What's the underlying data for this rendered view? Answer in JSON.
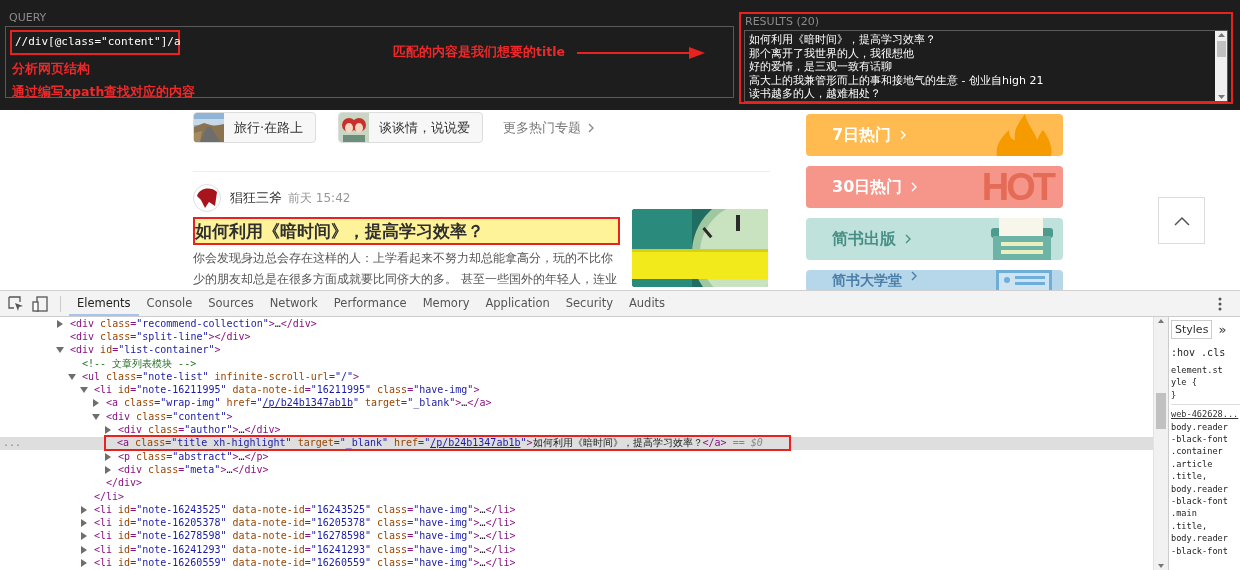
{
  "xpath_helper": {
    "query_label": "QUERY",
    "query": "//div[@class=\"content\"]/a",
    "annotations": [
      "分析网页结构",
      "通过编写xpath查找对应的内容"
    ],
    "arrow_note": "匹配的内容是我们想要的title",
    "results_label": "RESULTS (20)",
    "results": [
      "如何利用《暗时间》，提高学习效率？",
      "那个离开了我世界的人，我很想他",
      "好的爱情，是三观一致有话聊",
      "高大上的我兼管形而上的事和接地气的生意 - 创业自high 21",
      "读书越多的人，越难相处？"
    ]
  },
  "page": {
    "topics": [
      {
        "label": "旅行·在路上",
        "kind": "road"
      },
      {
        "label": "谈谈情，说说爱",
        "kind": "pair"
      }
    ],
    "more_topics": "更多热门专题",
    "article": {
      "author": "猖狂三斧",
      "time": "前天 15:42",
      "title": "如何利用《暗时间》，提高学习效率？",
      "framed": true,
      "abstract": "你会发现身边总会存在这样的人：上学看起来不努力却总能拿高分，玩的不比你少的朋友却总是在很多方面成就要比同侪大的多。 甚至一些国外的年轻人，连业"
    },
    "side_cards": [
      {
        "label": "7日热门",
        "kind": "flame",
        "color": "#ffbb4f"
      },
      {
        "label": "30日热门",
        "kind": "hot",
        "badge": "HOT",
        "color": "#f6968a"
      },
      {
        "label": "简书出版",
        "kind": "typewriter",
        "color": "#bfe3dc"
      },
      {
        "label": "简书大学堂",
        "kind": "board",
        "color": "#b6d6ea"
      }
    ]
  },
  "devtools": {
    "tabs": [
      {
        "label": "Elements",
        "selected": true
      },
      {
        "label": "Console",
        "selected": false
      },
      {
        "label": "Sources",
        "selected": false
      },
      {
        "label": "Network",
        "selected": false
      },
      {
        "label": "Performance",
        "selected": false
      },
      {
        "label": "Memory",
        "selected": false
      },
      {
        "label": "Application",
        "selected": false
      },
      {
        "label": "Security",
        "selected": false
      },
      {
        "label": "Audits",
        "selected": false
      }
    ],
    "tree": [
      {
        "kind": "toggle",
        "expanded": false,
        "selected": false,
        "tokens": [
          {
            "kind": "tag",
            "text": "<div"
          },
          {
            "kind": "attr",
            "text": " class"
          },
          {
            "kind": "punct",
            "text": "="
          },
          {
            "kind": "val",
            "text": "\"recommend-collection\""
          },
          {
            "kind": "tag",
            "text": ">"
          },
          {
            "kind": "text",
            "text": "…"
          },
          {
            "kind": "tag",
            "text": "</div>"
          }
        ]
      },
      {
        "kind": "leaf",
        "selected": false,
        "tokens": [
          {
            "kind": "tag",
            "text": "<div"
          },
          {
            "kind": "attr",
            "text": " class"
          },
          {
            "kind": "punct",
            "text": "="
          },
          {
            "kind": "val",
            "text": "\"split-line\""
          },
          {
            "kind": "tag",
            "text": "></div>"
          }
        ]
      },
      {
        "kind": "toggle",
        "expanded": true,
        "selected": false,
        "tokens": [
          {
            "kind": "tag",
            "text": "<div"
          },
          {
            "kind": "attr",
            "text": " id"
          },
          {
            "kind": "punct",
            "text": "="
          },
          {
            "kind": "val",
            "text": "\"list-container\""
          },
          {
            "kind": "tag",
            "text": ">"
          }
        ],
        "children": [
          {
            "kind": "leaf",
            "selected": false,
            "tokens": [
              {
                "kind": "comment",
                "text": "<!-- 文章列表模块 -->"
              }
            ]
          },
          {
            "kind": "toggle",
            "expanded": true,
            "selected": false,
            "tokens": [
              {
                "kind": "tag",
                "text": "<ul"
              },
              {
                "kind": "attr",
                "text": " class"
              },
              {
                "kind": "punct",
                "text": "="
              },
              {
                "kind": "val",
                "text": "\"note-list\""
              },
              {
                "kind": "attr",
                "text": " infinite-scroll-url"
              },
              {
                "kind": "punct",
                "text": "="
              },
              {
                "kind": "val",
                "text": "\"/\""
              },
              {
                "kind": "tag",
                "text": ">"
              }
            ],
            "children": [
              {
                "kind": "toggle",
                "expanded": true,
                "selected": false,
                "tokens": [
                  {
                    "kind": "tag",
                    "text": "<li"
                  },
                  {
                    "kind": "attr",
                    "text": " id"
                  },
                  {
                    "kind": "punct",
                    "text": "="
                  },
                  {
                    "kind": "val",
                    "text": "\"note-16211995\""
                  },
                  {
                    "kind": "attr",
                    "text": " data-note-id"
                  },
                  {
                    "kind": "punct",
                    "text": "="
                  },
                  {
                    "kind": "val",
                    "text": "\"16211995\""
                  },
                  {
                    "kind": "attr",
                    "text": " class"
                  },
                  {
                    "kind": "punct",
                    "text": "="
                  },
                  {
                    "kind": "val",
                    "text": "\"have-img\""
                  },
                  {
                    "kind": "tag",
                    "text": ">"
                  }
                ],
                "close": [
                  {
                    "kind": "tag",
                    "text": "</li>"
                  }
                ],
                "children": [
                  {
                    "kind": "toggle",
                    "expanded": false,
                    "selected": false,
                    "tokens": [
                      {
                        "kind": "tag",
                        "text": "<a"
                      },
                      {
                        "kind": "attr",
                        "text": " class"
                      },
                      {
                        "kind": "punct",
                        "text": "="
                      },
                      {
                        "kind": "val",
                        "text": "\"wrap-img\""
                      },
                      {
                        "kind": "attr",
                        "text": " href"
                      },
                      {
                        "kind": "punct",
                        "text": "="
                      },
                      {
                        "kind": "val",
                        "text": "\""
                      },
                      {
                        "kind": "link",
                        "text": "/p/b24b1347ab1b"
                      },
                      {
                        "kind": "val",
                        "text": "\""
                      },
                      {
                        "kind": "attr",
                        "text": " target"
                      },
                      {
                        "kind": "punct",
                        "text": "="
                      },
                      {
                        "kind": "val",
                        "text": "\"_blank\""
                      },
                      {
                        "kind": "tag",
                        "text": ">"
                      },
                      {
                        "kind": "text",
                        "text": "…"
                      },
                      {
                        "kind": "tag",
                        "text": "</a>"
                      }
                    ]
                  },
                  {
                    "kind": "toggle",
                    "expanded": true,
                    "selected": false,
                    "tokens": [
                      {
                        "kind": "tag",
                        "text": "<div"
                      },
                      {
                        "kind": "attr",
                        "text": " class"
                      },
                      {
                        "kind": "punct",
                        "text": "="
                      },
                      {
                        "kind": "val",
                        "text": "\"content\""
                      },
                      {
                        "kind": "tag",
                        "text": ">"
                      }
                    ],
                    "close": [
                      {
                        "kind": "tag",
                        "text": "</div>"
                      }
                    ],
                    "children": [
                      {
                        "kind": "toggle",
                        "expanded": false,
                        "selected": false,
                        "tokens": [
                          {
                            "kind": "tag",
                            "text": "<div"
                          },
                          {
                            "kind": "attr",
                            "text": " class"
                          },
                          {
                            "kind": "punct",
                            "text": "="
                          },
                          {
                            "kind": "val",
                            "text": "\"author\""
                          },
                          {
                            "kind": "tag",
                            "text": ">"
                          },
                          {
                            "kind": "text",
                            "text": "…"
                          },
                          {
                            "kind": "tag",
                            "text": "</div>"
                          }
                        ]
                      },
                      {
                        "kind": "leaf",
                        "selected": true,
                        "framed": true,
                        "gutter": "...",
                        "tokens": [
                          {
                            "kind": "tag",
                            "text": "<a"
                          },
                          {
                            "kind": "attr",
                            "text": " class"
                          },
                          {
                            "kind": "punct",
                            "text": "="
                          },
                          {
                            "kind": "val",
                            "text": "\"title xh-highlight\""
                          },
                          {
                            "kind": "attr",
                            "text": " target"
                          },
                          {
                            "kind": "punct",
                            "text": "="
                          },
                          {
                            "kind": "val",
                            "text": "\"_blank\""
                          },
                          {
                            "kind": "attr",
                            "text": " href"
                          },
                          {
                            "kind": "punct",
                            "text": "="
                          },
                          {
                            "kind": "val",
                            "text": "\""
                          },
                          {
                            "kind": "link",
                            "text": "/p/b24b1347ab1b"
                          },
                          {
                            "kind": "val",
                            "text": "\""
                          },
                          {
                            "kind": "tag",
                            "text": ">"
                          },
                          {
                            "kind": "text",
                            "text": "如何利用《暗时间》，提高学习效率？"
                          },
                          {
                            "kind": "tag",
                            "text": "</a>"
                          },
                          {
                            "kind": "ref",
                            "text": " == $0"
                          }
                        ]
                      },
                      {
                        "kind": "toggle",
                        "expanded": false,
                        "selected": false,
                        "tokens": [
                          {
                            "kind": "tag",
                            "text": "<p"
                          },
                          {
                            "kind": "attr",
                            "text": " class"
                          },
                          {
                            "kind": "punct",
                            "text": "="
                          },
                          {
                            "kind": "val",
                            "text": "\"abstract\""
                          },
                          {
                            "kind": "tag",
                            "text": ">"
                          },
                          {
                            "kind": "text",
                            "text": "…"
                          },
                          {
                            "kind": "tag",
                            "text": "</p>"
                          }
                        ]
                      },
                      {
                        "kind": "toggle",
                        "expanded": false,
                        "selected": false,
                        "tokens": [
                          {
                            "kind": "tag",
                            "text": "<div"
                          },
                          {
                            "kind": "attr",
                            "text": " class"
                          },
                          {
                            "kind": "punct",
                            "text": "="
                          },
                          {
                            "kind": "val",
                            "text": "\"meta\""
                          },
                          {
                            "kind": "tag",
                            "text": ">"
                          },
                          {
                            "kind": "text",
                            "text": "…"
                          },
                          {
                            "kind": "tag",
                            "text": "</div>"
                          }
                        ]
                      }
                    ]
                  }
                ]
              },
              {
                "kind": "toggle",
                "expanded": false,
                "selected": false,
                "tokens": [
                  {
                    "kind": "tag",
                    "text": "<li"
                  },
                  {
                    "kind": "attr",
                    "text": " id"
                  },
                  {
                    "kind": "punct",
                    "text": "="
                  },
                  {
                    "kind": "val",
                    "text": "\"note-16243525\""
                  },
                  {
                    "kind": "attr",
                    "text": " data-note-id"
                  },
                  {
                    "kind": "punct",
                    "text": "="
                  },
                  {
                    "kind": "val",
                    "text": "\"16243525\""
                  },
                  {
                    "kind": "attr",
                    "text": " class"
                  },
                  {
                    "kind": "punct",
                    "text": "="
                  },
                  {
                    "kind": "val",
                    "text": "\"have-img\""
                  },
                  {
                    "kind": "tag",
                    "text": ">"
                  },
                  {
                    "kind": "text",
                    "text": "…"
                  },
                  {
                    "kind": "tag",
                    "text": "</li>"
                  }
                ]
              },
              {
                "kind": "toggle",
                "expanded": false,
                "selected": false,
                "tokens": [
                  {
                    "kind": "tag",
                    "text": "<li"
                  },
                  {
                    "kind": "attr",
                    "text": " id"
                  },
                  {
                    "kind": "punct",
                    "text": "="
                  },
                  {
                    "kind": "val",
                    "text": "\"note-16205378\""
                  },
                  {
                    "kind": "attr",
                    "text": " data-note-id"
                  },
                  {
                    "kind": "punct",
                    "text": "="
                  },
                  {
                    "kind": "val",
                    "text": "\"16205378\""
                  },
                  {
                    "kind": "attr",
                    "text": " class"
                  },
                  {
                    "kind": "punct",
                    "text": "="
                  },
                  {
                    "kind": "val",
                    "text": "\"have-img\""
                  },
                  {
                    "kind": "tag",
                    "text": ">"
                  },
                  {
                    "kind": "text",
                    "text": "…"
                  },
                  {
                    "kind": "tag",
                    "text": "</li>"
                  }
                ]
              },
              {
                "kind": "toggle",
                "expanded": false,
                "selected": false,
                "tokens": [
                  {
                    "kind": "tag",
                    "text": "<li"
                  },
                  {
                    "kind": "attr",
                    "text": " id"
                  },
                  {
                    "kind": "punct",
                    "text": "="
                  },
                  {
                    "kind": "val",
                    "text": "\"note-16278598\""
                  },
                  {
                    "kind": "attr",
                    "text": " data-note-id"
                  },
                  {
                    "kind": "punct",
                    "text": "="
                  },
                  {
                    "kind": "val",
                    "text": "\"16278598\""
                  },
                  {
                    "kind": "attr",
                    "text": " class"
                  },
                  {
                    "kind": "punct",
                    "text": "="
                  },
                  {
                    "kind": "val",
                    "text": "\"have-img\""
                  },
                  {
                    "kind": "tag",
                    "text": ">"
                  },
                  {
                    "kind": "text",
                    "text": "…"
                  },
                  {
                    "kind": "tag",
                    "text": "</li>"
                  }
                ]
              },
              {
                "kind": "toggle",
                "expanded": false,
                "selected": false,
                "tokens": [
                  {
                    "kind": "tag",
                    "text": "<li"
                  },
                  {
                    "kind": "attr",
                    "text": " id"
                  },
                  {
                    "kind": "punct",
                    "text": "="
                  },
                  {
                    "kind": "val",
                    "text": "\"note-16241293\""
                  },
                  {
                    "kind": "attr",
                    "text": " data-note-id"
                  },
                  {
                    "kind": "punct",
                    "text": "="
                  },
                  {
                    "kind": "val",
                    "text": "\"16241293\""
                  },
                  {
                    "kind": "attr",
                    "text": " class"
                  },
                  {
                    "kind": "punct",
                    "text": "="
                  },
                  {
                    "kind": "val",
                    "text": "\"have-img\""
                  },
                  {
                    "kind": "tag",
                    "text": ">"
                  },
                  {
                    "kind": "text",
                    "text": "…"
                  },
                  {
                    "kind": "tag",
                    "text": "</li>"
                  }
                ]
              },
              {
                "kind": "toggle",
                "expanded": false,
                "selected": false,
                "tokens": [
                  {
                    "kind": "tag",
                    "text": "<li"
                  },
                  {
                    "kind": "attr",
                    "text": " id"
                  },
                  {
                    "kind": "punct",
                    "text": "="
                  },
                  {
                    "kind": "val",
                    "text": "\"note-16260559\""
                  },
                  {
                    "kind": "attr",
                    "text": " data-note-id"
                  },
                  {
                    "kind": "punct",
                    "text": "="
                  },
                  {
                    "kind": "val",
                    "text": "\"16260559\""
                  },
                  {
                    "kind": "attr",
                    "text": " class"
                  },
                  {
                    "kind": "punct",
                    "text": "="
                  },
                  {
                    "kind": "val",
                    "text": "\"have-img\""
                  },
                  {
                    "kind": "tag",
                    "text": ">"
                  },
                  {
                    "kind": "text",
                    "text": "…"
                  },
                  {
                    "kind": "tag",
                    "text": "</li>"
                  }
                ]
              }
            ]
          }
        ]
      }
    ],
    "styles": {
      "tab": "Styles",
      "more": "»",
      "filters": [
        ":hov",
        ".cls"
      ],
      "rules": [
        {
          "lines": [
            "element.st",
            "yle {",
            "}"
          ]
        },
        {
          "source": "web-462628...",
          "lines": [
            "body.reader",
            "-black-font",
            ".container",
            ".article",
            ".title,",
            "body.reader",
            "-black-font",
            ".main",
            ".title,",
            "body.reader",
            "-black-font"
          ]
        }
      ]
    }
  }
}
